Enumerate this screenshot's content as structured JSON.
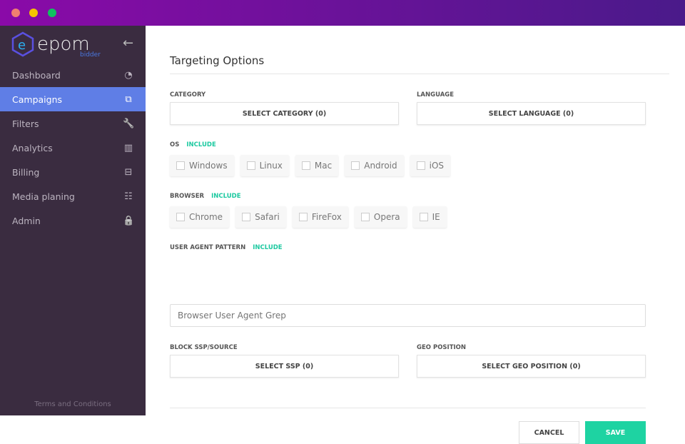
{
  "sidebar": {
    "logo": "epom",
    "logo_sub": "bidder",
    "items": [
      {
        "label": "Dashboard",
        "icon": "◔"
      },
      {
        "label": "Campaigns",
        "icon": "⧉"
      },
      {
        "label": "Filters",
        "icon": "🔧"
      },
      {
        "label": "Analytics",
        "icon": "▥"
      },
      {
        "label": "Billing",
        "icon": "⊟"
      },
      {
        "label": "Media planing",
        "icon": "☷"
      },
      {
        "label": "Admin",
        "icon": "🔒"
      }
    ],
    "terms": "Terms and Conditions"
  },
  "main": {
    "title": "Targeting Options",
    "category_label": "CATEGORY",
    "category_button": "SELECT CATEGORY (0)",
    "language_label": "LANGUAGE",
    "language_button": "SELECT LANGUAGE (0)",
    "os_label": "OS",
    "os_include": "INCLUDE",
    "os": [
      "Windows",
      "Linux",
      "Mac",
      "Android",
      "iOS"
    ],
    "browser_label": "BROWSER",
    "browser_include": "INCLUDE",
    "browsers": [
      "Chrome",
      "Safari",
      "FireFox",
      "Opera",
      "IE"
    ],
    "ua_label": "USER AGENT PATTERN",
    "ua_include": "INCLUDE",
    "ua_placeholder": "Browser User Agent Grep",
    "ssp_label": "BLOCK SSP/SOURCE",
    "ssp_button": "SELECT SSP (0)",
    "geo_label": "GEO POSITION",
    "geo_button": "SELECT GEO POSITION (0)",
    "cancel": "CANCEL",
    "save": "SAVE"
  }
}
